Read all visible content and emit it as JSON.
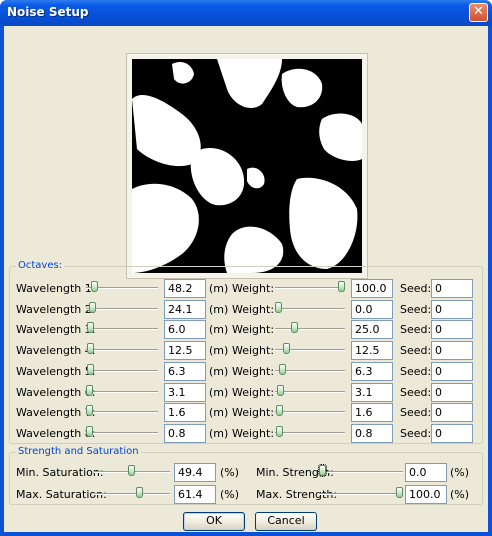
{
  "window": {
    "title": "Noise Setup"
  },
  "icons": {
    "close": "close-icon"
  },
  "octaves": {
    "group_label": "Octaves:",
    "unit_m": "(m)",
    "weight_label": "Weight:",
    "seed_label": "Seed:",
    "rows": [
      {
        "label": "Wavelength 1:",
        "wavelength": "48.2",
        "weight": "100.0",
        "seed": "0",
        "wl_slider": 0.08,
        "w_slider": 1.0
      },
      {
        "label": "Wavelength 2:",
        "wavelength": "24.1",
        "weight": "0.0",
        "seed": "0",
        "wl_slider": 0.04,
        "w_slider": 0.0
      },
      {
        "label": "Wavelength 3:",
        "wavelength": "6.0",
        "weight": "25.0",
        "seed": "0",
        "wl_slider": 0.01,
        "w_slider": 0.25
      },
      {
        "label": "Wavelength 4:",
        "wavelength": "12.5",
        "weight": "12.5",
        "seed": "0",
        "wl_slider": 0.02,
        "w_slider": 0.125
      },
      {
        "label": "Wavelength 5:",
        "wavelength": "6.3",
        "weight": "6.3",
        "seed": "0",
        "wl_slider": 0.01,
        "w_slider": 0.063
      },
      {
        "label": "Wavelength 6:",
        "wavelength": "3.1",
        "weight": "3.1",
        "seed": "0",
        "wl_slider": 0.0,
        "w_slider": 0.031
      },
      {
        "label": "Wavelength 7:",
        "wavelength": "1.6",
        "weight": "1.6",
        "seed": "0",
        "wl_slider": 0.0,
        "w_slider": 0.016
      },
      {
        "label": "Wavelength 8:",
        "wavelength": "0.8",
        "weight": "0.8",
        "seed": "0",
        "wl_slider": 0.0,
        "w_slider": 0.008
      }
    ]
  },
  "strength": {
    "group_label": "Strength and Saturation",
    "unit_pct": "(%)",
    "min_saturation": {
      "label": "Min. Saturation:",
      "value": "49.4",
      "slider": 0.494
    },
    "max_saturation": {
      "label": "Max. Saturation:",
      "value": "61.4",
      "slider": 0.614
    },
    "min_strength": {
      "label": "Min. Strength:",
      "value": "0.0",
      "slider": 0.0
    },
    "max_strength": {
      "label": "Max. Strength:",
      "value": "100.0",
      "slider": 1.0
    }
  },
  "buttons": {
    "ok": "OK",
    "cancel": "Cancel"
  }
}
